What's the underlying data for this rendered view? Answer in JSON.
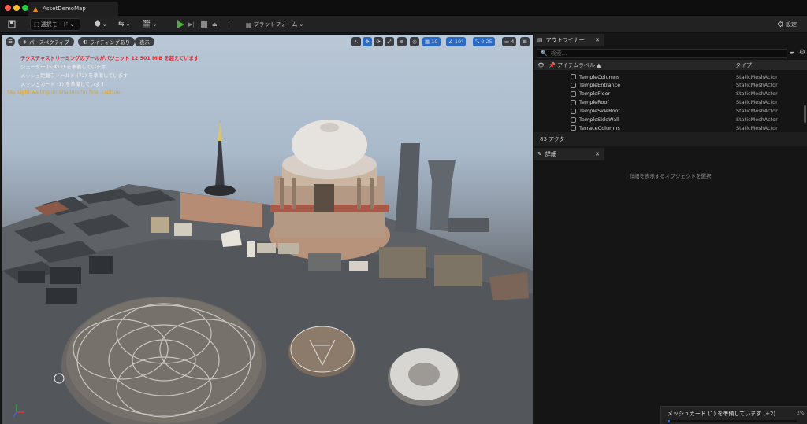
{
  "window": {
    "tab_title": "AssetDemoMap"
  },
  "toolbar": {
    "select_mode": "選択モード",
    "platform": "プラットフォーム",
    "settings": "設定"
  },
  "viewport": {
    "perspective": "パースペクティブ",
    "lighting": "ライティングあり",
    "show": "表示",
    "grid_snap": "10",
    "rot_snap": "10°",
    "scale_snap": "0.25",
    "camera_speed": "4",
    "messages": [
      {
        "text": "テクスチャストリーミングのプールがバジェット 12.501 MiB を超えています",
        "color": "#e8262b",
        "bold": true
      },
      {
        "text": "シェーダー (5,417) を準備しています",
        "color": "#f0f0f0",
        "bold": false
      },
      {
        "text": "メッシュ距離フィールド (72) を準備しています",
        "color": "#f0f0f0",
        "bold": false
      },
      {
        "text": "メッシュカード (1) を準備しています",
        "color": "#f0f0f0",
        "bold": false
      },
      {
        "text": "Sky Light waiting on Shaders for final capture.",
        "color": "#e8a216",
        "bold": false
      }
    ]
  },
  "outliner": {
    "tab": "アウトライナー",
    "search_placeholder": "検索...",
    "col_label": "アイテムラベル ▲",
    "col_type": "タイプ",
    "rows": [
      {
        "name": "TempleColumns",
        "type": "StaticMeshActor"
      },
      {
        "name": "TempleEntrance",
        "type": "StaticMeshActor"
      },
      {
        "name": "TempleFloor",
        "type": "StaticMeshActor"
      },
      {
        "name": "TempleRoof",
        "type": "StaticMeshActor"
      },
      {
        "name": "TempleSideRoof",
        "type": "StaticMeshActor"
      },
      {
        "name": "TempleSideWall",
        "type": "StaticMeshActor"
      },
      {
        "name": "TerraceColumns",
        "type": "StaticMeshActor"
      }
    ],
    "actor_count": "83 アクタ"
  },
  "details": {
    "tab": "詳細",
    "empty_msg": "詳細を表示するオブジェクトを選択"
  },
  "status": {
    "progress_text": "メッシュカード (1) を準備しています (+2)",
    "progress_pct": "2%",
    "progress_value": 0.02
  },
  "colors": {
    "accent": "#2a6ac2",
    "play": "#4caf3a"
  }
}
